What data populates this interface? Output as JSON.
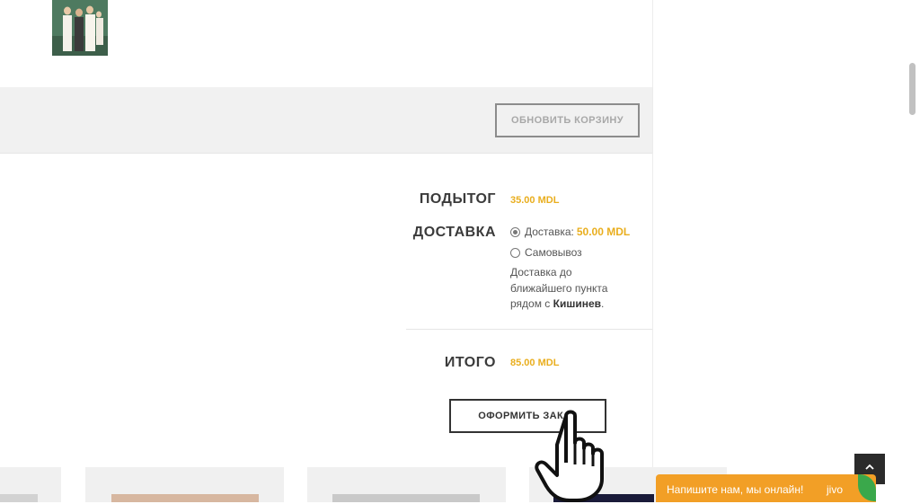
{
  "cart": {
    "update_button": "ОБНОВИТЬ КОРЗИНУ"
  },
  "totals": {
    "subtotal_label": "ПОДЫТОГ",
    "subtotal_value": "35.00 MDL",
    "shipping_label": "ДОСТАВКА",
    "shipping_option_1_label": "Доставка:",
    "shipping_option_1_price": "50.00 MDL",
    "shipping_option_2_label": "Самовывоз",
    "shipping_note_prefix": "Доставка до ближайшего пункта рядом с",
    "shipping_note_city": "Кишинев",
    "shipping_note_suffix": ".",
    "total_label": "ИТОГО",
    "total_value": "85.00 MDL",
    "checkout_button": "ОФОРМИТЬ ЗАКАЗ"
  },
  "widgets": {
    "scroll_top_icon": "chevron-up-icon",
    "chat_text": "Напишите нам, мы онлайн!",
    "chat_brand": "jivo"
  },
  "colors": {
    "accent_price": "#e9ae1e",
    "chat_orange": "#f29f26",
    "chat_leaf_green": "#3aa84b"
  }
}
